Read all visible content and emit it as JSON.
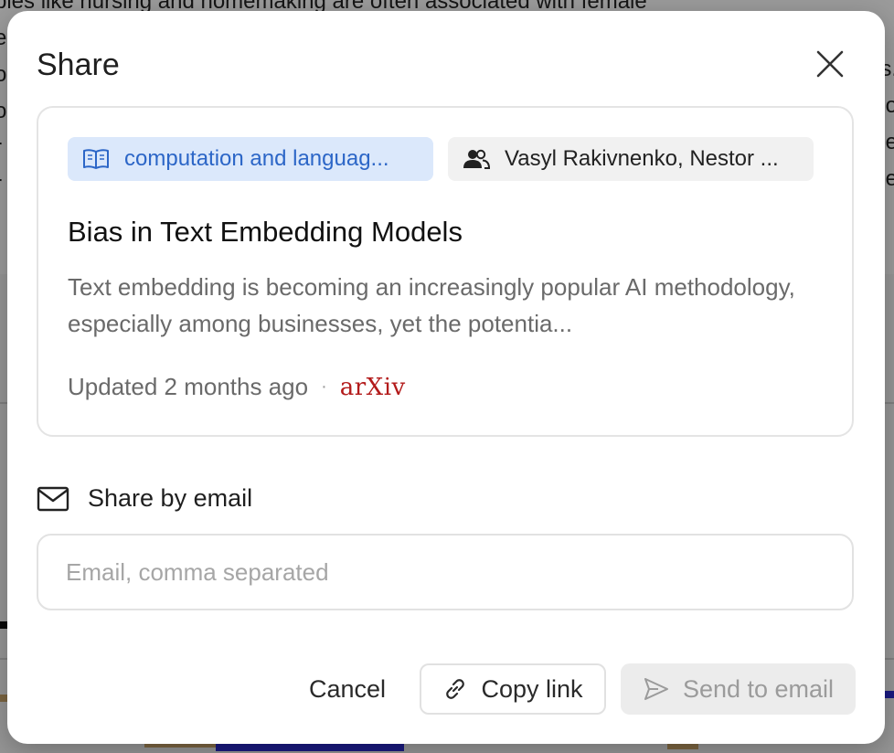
{
  "background": {
    "text_lines": [
      "bles like nursing and homemaking are often associated with female",
      "e",
      "o",
      "o",
      "r",
      "r",
      "i"
    ],
    "right_glyphs": [
      "s.",
      "o",
      "e",
      "e"
    ]
  },
  "modal": {
    "title": "Share",
    "close_icon": "close-icon"
  },
  "card": {
    "category_tag": {
      "icon": "book-open-icon",
      "label": "computation and languag..."
    },
    "authors_tag": {
      "icon": "people-icon",
      "label": "Vasyl Rakivnenko, Nestor ..."
    },
    "title": "Bias in Text Embedding Models",
    "abstract": "Text embedding is becoming an increasingly popular AI methodology, especially among businesses, yet the potentia...",
    "updated": "Updated 2 months ago",
    "separator": "·",
    "source": "arXiv"
  },
  "email": {
    "icon": "mail-icon",
    "heading": "Share by email",
    "placeholder": "Email, comma separated",
    "value": ""
  },
  "buttons": {
    "cancel": "Cancel",
    "copy_link": "Copy link",
    "send_to_email": "Send to email"
  },
  "colors": {
    "category_bg": "#dbe8fb",
    "category_text": "#2c66c7",
    "arxiv_red": "#b31b1b",
    "send_disabled_bg": "#ececec"
  }
}
